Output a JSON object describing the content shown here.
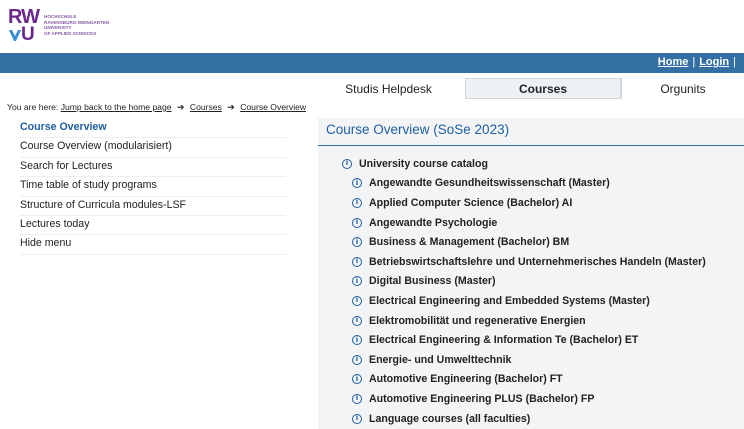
{
  "logo": {
    "mark": "RW",
    "mark2": "U",
    "text_line1": "HOCHSCHULE",
    "text_line2": "RAVENSBURG-WEINGARTEN",
    "text_line3": "UNIVERSITY",
    "text_line4": "OF APPLIED SCIENCES"
  },
  "topbar": {
    "home": "Home",
    "separator": "|",
    "login": "Login",
    "trailing": "|"
  },
  "tabs": [
    {
      "label": "Studis Helpdesk"
    },
    {
      "label": "Courses"
    },
    {
      "label": "Orgunits"
    }
  ],
  "breadcrumb": {
    "prefix": "You are here:",
    "items": [
      "Jump back to the home page",
      "Courses",
      "Course Overview"
    ],
    "arrow": "➔"
  },
  "leftmenu": [
    {
      "label": "Course Overview"
    },
    {
      "label": "Course Overview (modularisiert)"
    },
    {
      "label": "Search for Lectures"
    },
    {
      "label": "Time table of study programs"
    },
    {
      "label": "Structure of Curricula modules-LSF"
    },
    {
      "label": "Lectures today"
    },
    {
      "label": "Hide menu"
    }
  ],
  "main": {
    "title": "Course Overview (SoSe 2023)",
    "root": "University course catalog",
    "info_glyph": "i",
    "items": [
      "Angewandte Gesundheitswissenschaft (Master)",
      "Applied Computer Science (Bachelor) AI",
      "Angewandte Psychologie",
      "Business & Management (Bachelor) BM",
      "Betriebswirtschaftslehre und Unternehmerisches Handeln (Master)",
      "Digital Business (Master)",
      "Electrical Engineering and Embedded Systems (Master)",
      "Elektromobilität und regenerative Energien",
      "Electrical Engineering & Information Te (Bachelor) ET",
      "Energie- und Umwelttechnik",
      "Automotive Engineering (Bachelor) FT",
      "Automotive Engineering PLUS (Bachelor) FP",
      "Language courses (all faculties)"
    ]
  },
  "colors": {
    "brand_purple": "#6a2a8c",
    "bar_blue": "#336fa3",
    "link_blue": "#1f5fa0",
    "panel_bg": "#f2f4f6"
  }
}
